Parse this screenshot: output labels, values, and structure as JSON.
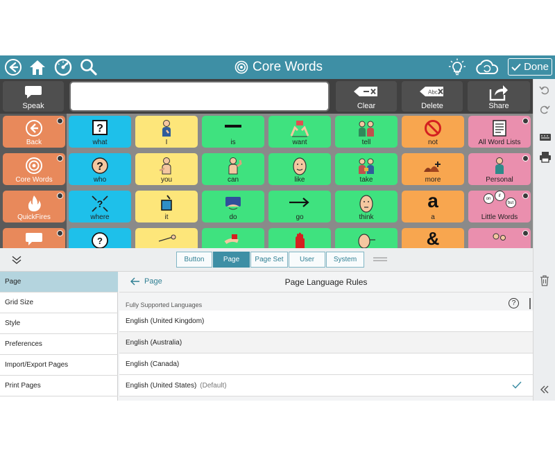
{
  "topbar": {
    "title": "Core Words",
    "done_label": "Done",
    "icons": [
      "back-arrow-icon",
      "home-icon",
      "speedometer-icon",
      "search-icon",
      "lightbulb-icon",
      "cloud-sync-icon",
      "checkmark-icon"
    ]
  },
  "message_bar": {
    "speak_label": "Speak",
    "clear_label": "Clear",
    "delete_label": "Delete",
    "share_label": "Share",
    "clear_icon_text": "✕",
    "delete_icon_text": "Abc"
  },
  "grid": {
    "nav": [
      {
        "label": "Back",
        "icon": "back-arrow-icon"
      },
      {
        "label": "Core Words",
        "icon": "target-icon"
      },
      {
        "label": "QuickFires",
        "icon": "flame-icon"
      },
      {
        "label": "",
        "icon": "speech-bubble-icon"
      }
    ],
    "rows": [
      [
        {
          "label": "what",
          "color": "#1ec0ea",
          "icon": "question-box-icon"
        },
        {
          "label": "I",
          "color": "#fde67a",
          "icon": "person-self-icon"
        },
        {
          "label": "is",
          "color": "#3fe27f",
          "icon": "dash-icon"
        },
        {
          "label": "want",
          "color": "#3fe27f",
          "icon": "hands-reach-icon"
        },
        {
          "label": "tell",
          "color": "#3fe27f",
          "icon": "two-people-talking-icon"
        },
        {
          "label": "not",
          "color": "#f8a64f",
          "icon": "no-symbol-icon"
        },
        {
          "label": "All Word Lists",
          "color": "#ea8fae",
          "icon": "list-document-icon"
        }
      ],
      [
        {
          "label": "who",
          "color": "#1ec0ea",
          "icon": "question-face-icon"
        },
        {
          "label": "you",
          "color": "#fde67a",
          "icon": "person-pointing-icon"
        },
        {
          "label": "can",
          "color": "#3fe27f",
          "icon": "strong-arm-person-icon"
        },
        {
          "label": "like",
          "color": "#3fe27f",
          "icon": "smiling-face-icon"
        },
        {
          "label": "take",
          "color": "#3fe27f",
          "icon": "people-exchange-icon"
        },
        {
          "label": "more",
          "color": "#f8a64f",
          "icon": "pile-more-icon"
        },
        {
          "label": "Personal",
          "color": "#ea8fae",
          "icon": "person-personal-icon"
        }
      ],
      [
        {
          "label": "where",
          "color": "#1ec0ea",
          "icon": "question-arrows-icon"
        },
        {
          "label": "it",
          "color": "#fde67a",
          "icon": "pointing-box-icon"
        },
        {
          "label": "do",
          "color": "#3fe27f",
          "icon": "hand-doing-icon"
        },
        {
          "label": "go",
          "color": "#3fe27f",
          "icon": "arrow-right-icon"
        },
        {
          "label": "think",
          "color": "#3fe27f",
          "icon": "thinking-face-icon"
        },
        {
          "label": "a",
          "color": "#f8a64f",
          "glyph": "a",
          "icon": "letter-a-icon"
        },
        {
          "label": "Little Words",
          "color": "#ea8fae",
          "icon": "little-words-bubbles-icon"
        }
      ],
      [
        {
          "label": "",
          "color": "#1ec0ea",
          "icon": "clock-question-icon"
        },
        {
          "label": "",
          "color": "#fde67a",
          "icon": "pointing-person-icon"
        },
        {
          "label": "",
          "color": "#3fe27f",
          "icon": "hand-giving-icon"
        },
        {
          "label": "",
          "color": "#3fe27f",
          "icon": "stop-hand-icon"
        },
        {
          "label": "",
          "color": "#3fe27f",
          "icon": "face-pointing-icon"
        },
        {
          "label": "",
          "color": "#f8a64f",
          "glyph": "&",
          "icon": "ampersand-icon"
        },
        {
          "label": "",
          "color": "#ea8fae",
          "icon": "people-icon"
        }
      ]
    ],
    "little_words_bubbles": [
      "on",
      "if",
      "but"
    ]
  },
  "editor": {
    "tabs": [
      "Button",
      "Page",
      "Page Set",
      "User",
      "System"
    ],
    "active_tab": "Page",
    "side_menu": [
      "Page",
      "Grid Size",
      "Style",
      "Preferences",
      "Import/Export Pages",
      "Print Pages"
    ],
    "active_side": "Page",
    "back_label": "Page",
    "heading": "Page Language Rules",
    "section_label": "Fully Supported Languages",
    "help_icon_text": "?",
    "languages": [
      {
        "name": "English (United Kingdom)",
        "suffix": "",
        "checked": false
      },
      {
        "name": "English (Australia)",
        "suffix": "",
        "checked": false
      },
      {
        "name": "English (Canada)",
        "suffix": "",
        "checked": false
      },
      {
        "name": "English (United States)",
        "suffix": "(Default)",
        "checked": true
      }
    ]
  },
  "colors": {
    "accent": "#3e8fa5",
    "nav_button": "#e8895b",
    "message_bar": "#404040"
  }
}
